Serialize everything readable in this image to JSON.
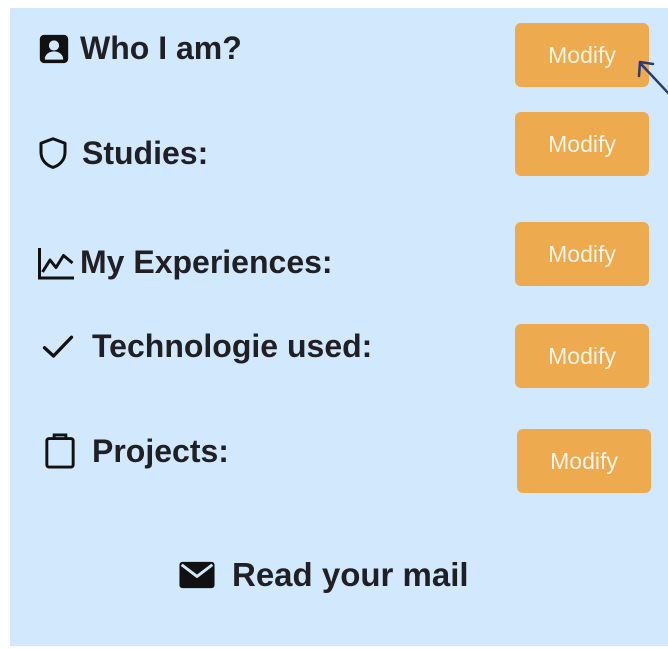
{
  "sections": [
    {
      "label": "Who I am?",
      "icon": "person-card-icon",
      "button": "Modify"
    },
    {
      "label": "Studies:",
      "icon": "shield-icon",
      "button": "Modify"
    },
    {
      "label": "My Experiences:",
      "icon": "line-chart-icon",
      "button": "Modify"
    },
    {
      "label": "Technologie used:",
      "icon": "checkmark-icon",
      "button": "Modify"
    },
    {
      "label": "Projects:",
      "icon": "clipboard-icon",
      "button": "Modify"
    }
  ],
  "mail": {
    "label": "Read your mail",
    "icon": "envelope-icon"
  },
  "colors": {
    "panel_background": "#d1e8fd",
    "button_background": "#eeaa4e",
    "button_text": "#fdf4e6",
    "text": "#1f1f24",
    "arrow": "#2b3a78"
  }
}
